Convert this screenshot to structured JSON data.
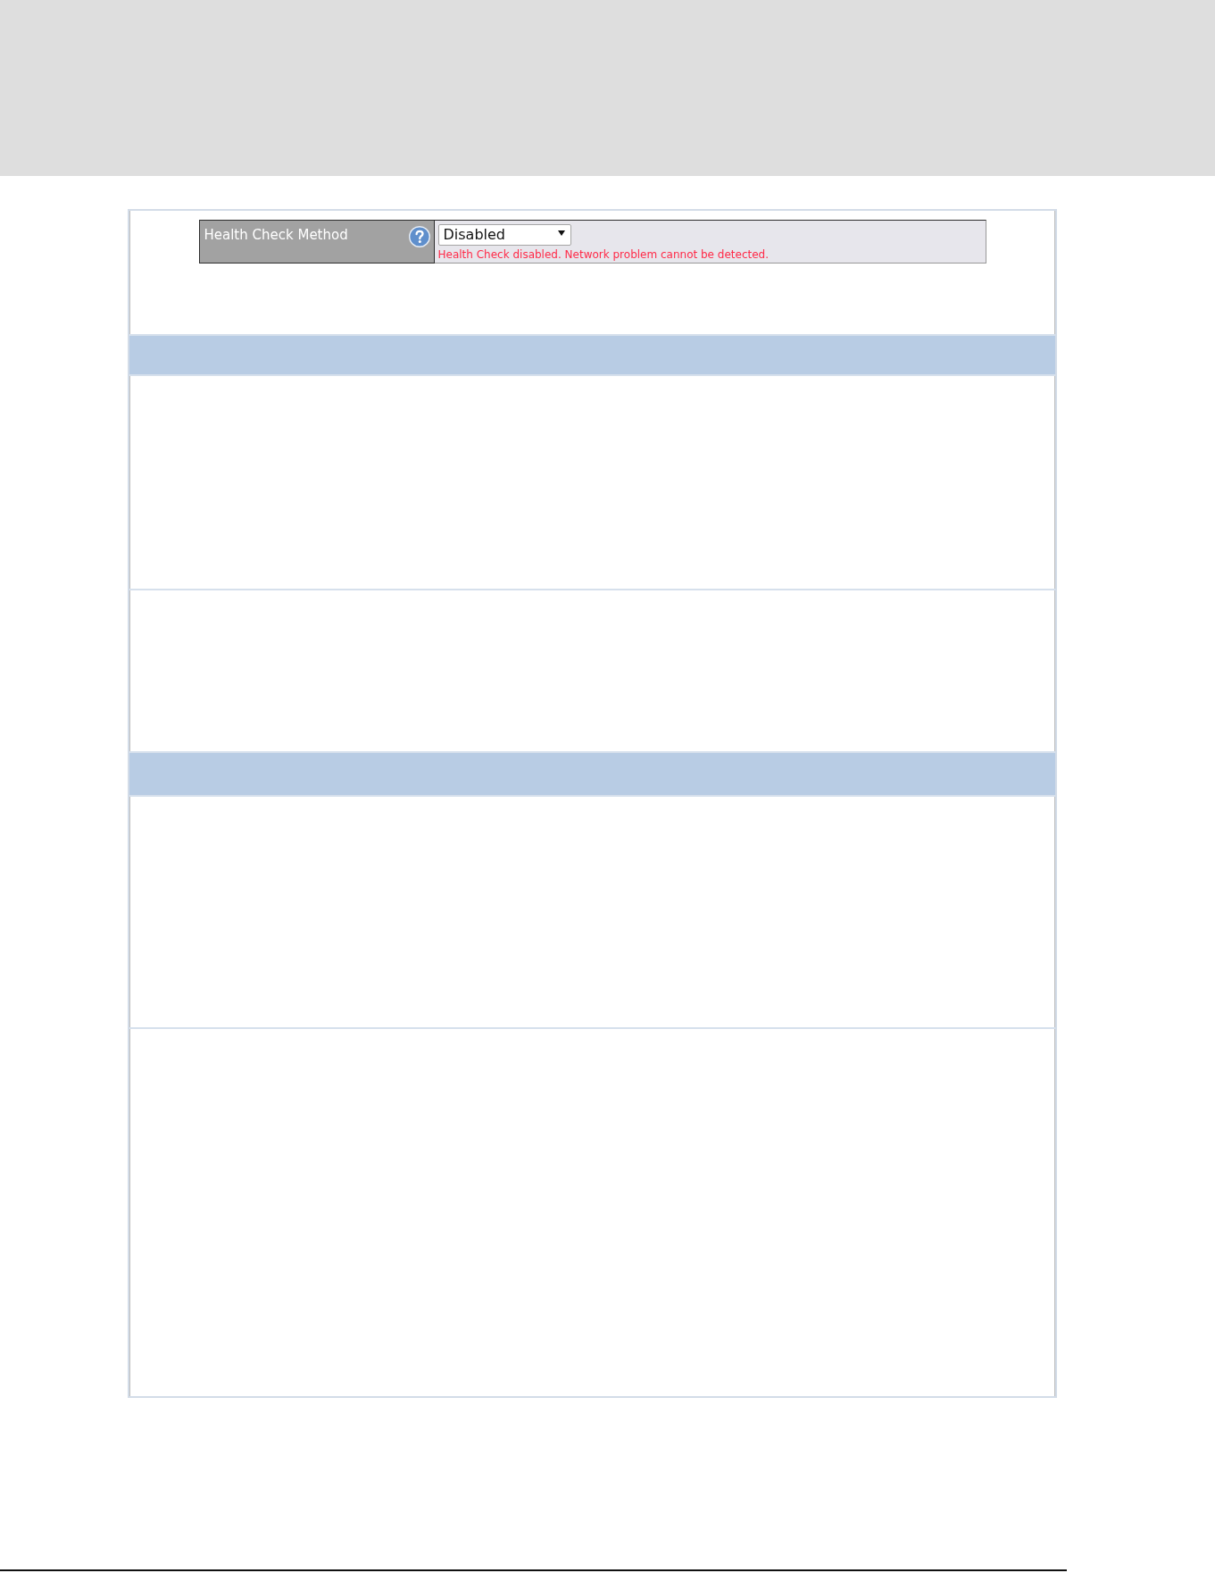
{
  "health_check": {
    "label": "Health Check Method",
    "select": {
      "value": "Disabled"
    },
    "message": "Health Check disabled. Network problem cannot be detected."
  }
}
